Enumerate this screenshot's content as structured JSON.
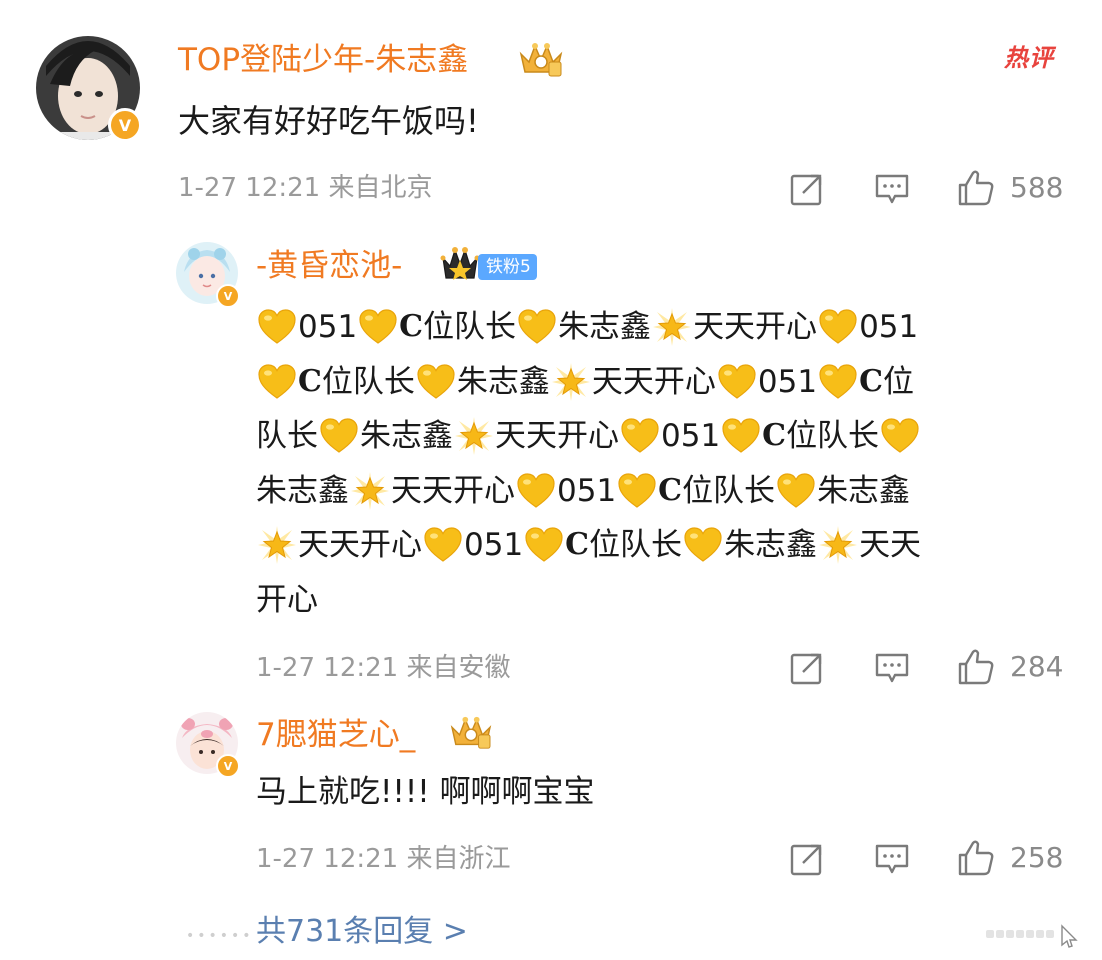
{
  "hot_tag": "热评",
  "main_comment": {
    "username": "TOP登陆少年-朱志鑫",
    "text": "大家有好好吃午饭吗!",
    "meta": "1-27 12:21 来自北京",
    "likes": "588",
    "verified_badge": "V"
  },
  "replies": [
    {
      "username": "-黄昏恋池-",
      "fan_badge": "铁粉5",
      "lines": [
        [
          "heart",
          "051",
          "heart",
          "C",
          "位队长",
          "heart",
          "朱志鑫",
          "star",
          "天天开心",
          "heart",
          "051"
        ],
        [
          "heart",
          "C",
          "位队长",
          "heart",
          "朱志鑫",
          "star",
          "天天开心",
          "heart",
          "051",
          "heart",
          "C",
          "位"
        ],
        [
          "队长",
          "heart",
          "朱志鑫",
          "star",
          "天天开心",
          "heart",
          "051",
          "heart",
          "C",
          "位队长",
          "heart"
        ],
        [
          "朱志鑫",
          "star",
          "天天开心",
          "heart",
          "051",
          "heart",
          "C",
          "位队长",
          "heart",
          "朱志鑫"
        ],
        [
          "star",
          "天天开心",
          "heart",
          "051",
          "heart",
          "C",
          "位队长",
          "heart",
          "朱志鑫",
          "star",
          "天天"
        ],
        [
          "开心"
        ]
      ],
      "meta": "1-27 12:21 来自安徽",
      "likes": "284",
      "verified_badge": "V"
    },
    {
      "username": "7腮猫芝心_",
      "text": "马上就吃!!!! 啊啊啊宝宝",
      "meta": "1-27 12:21 来自浙江",
      "likes": "258",
      "verified_badge": "V"
    }
  ],
  "more_replies": "共731条回复 >",
  "colors": {
    "username": "#f07a22",
    "meta": "#9a9a9a",
    "link": "#5a7fb0",
    "hot": "#e8433d",
    "badge": "#f5a623"
  }
}
